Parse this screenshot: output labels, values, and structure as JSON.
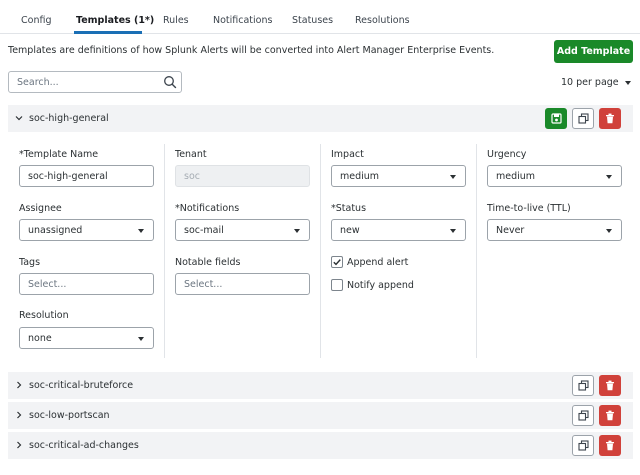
{
  "tabs": [
    "Config",
    "Templates (1*)",
    "Rules",
    "Notifications",
    "Statuses",
    "Resolutions"
  ],
  "description": "Templates are definitions of how Splunk Alerts will be converted into Alert Manager Enterprise Events.",
  "add_button": "Add Template",
  "search": {
    "placeholder": "Search..."
  },
  "per_page": "10 per page",
  "expanded": {
    "name": "soc-high-general",
    "fields": {
      "template_name": {
        "label": "Template Name",
        "required": "*",
        "value": "soc-high-general"
      },
      "tenant": {
        "label": "Tenant",
        "value": "soc"
      },
      "impact": {
        "label": "Impact",
        "value": "medium"
      },
      "urgency": {
        "label": "Urgency",
        "value": "medium"
      },
      "assignee": {
        "label": "Assignee",
        "value": "unassigned"
      },
      "notifications": {
        "label": "Notifications",
        "required": "*",
        "value": "soc-mail"
      },
      "status": {
        "label": "Status",
        "required": "*",
        "value": "new"
      },
      "ttl": {
        "label": "Time-to-live (TTL)",
        "value": "Never"
      },
      "tags": {
        "label": "Tags",
        "placeholder": "Select..."
      },
      "notable_fields": {
        "label": "Notable fields",
        "placeholder": "Select..."
      },
      "append_alert": {
        "label": "Append alert",
        "checked": true
      },
      "notify_append": {
        "label": "Notify append",
        "checked": false
      },
      "resolution": {
        "label": "Resolution",
        "value": "none"
      }
    }
  },
  "collapsed": [
    {
      "name": "soc-critical-bruteforce"
    },
    {
      "name": "soc-low-portscan"
    },
    {
      "name": "soc-critical-ad-changes"
    }
  ],
  "colors": {
    "accent": "#1a6fb5",
    "success": "#1a8929",
    "danger": "#d0413a",
    "row_bg": "#f2f3f5"
  },
  "icons": {
    "save": "save-icon",
    "copy": "copy-icon",
    "delete": "trash-icon",
    "expand": "chevron-icon",
    "search": "search-icon"
  }
}
